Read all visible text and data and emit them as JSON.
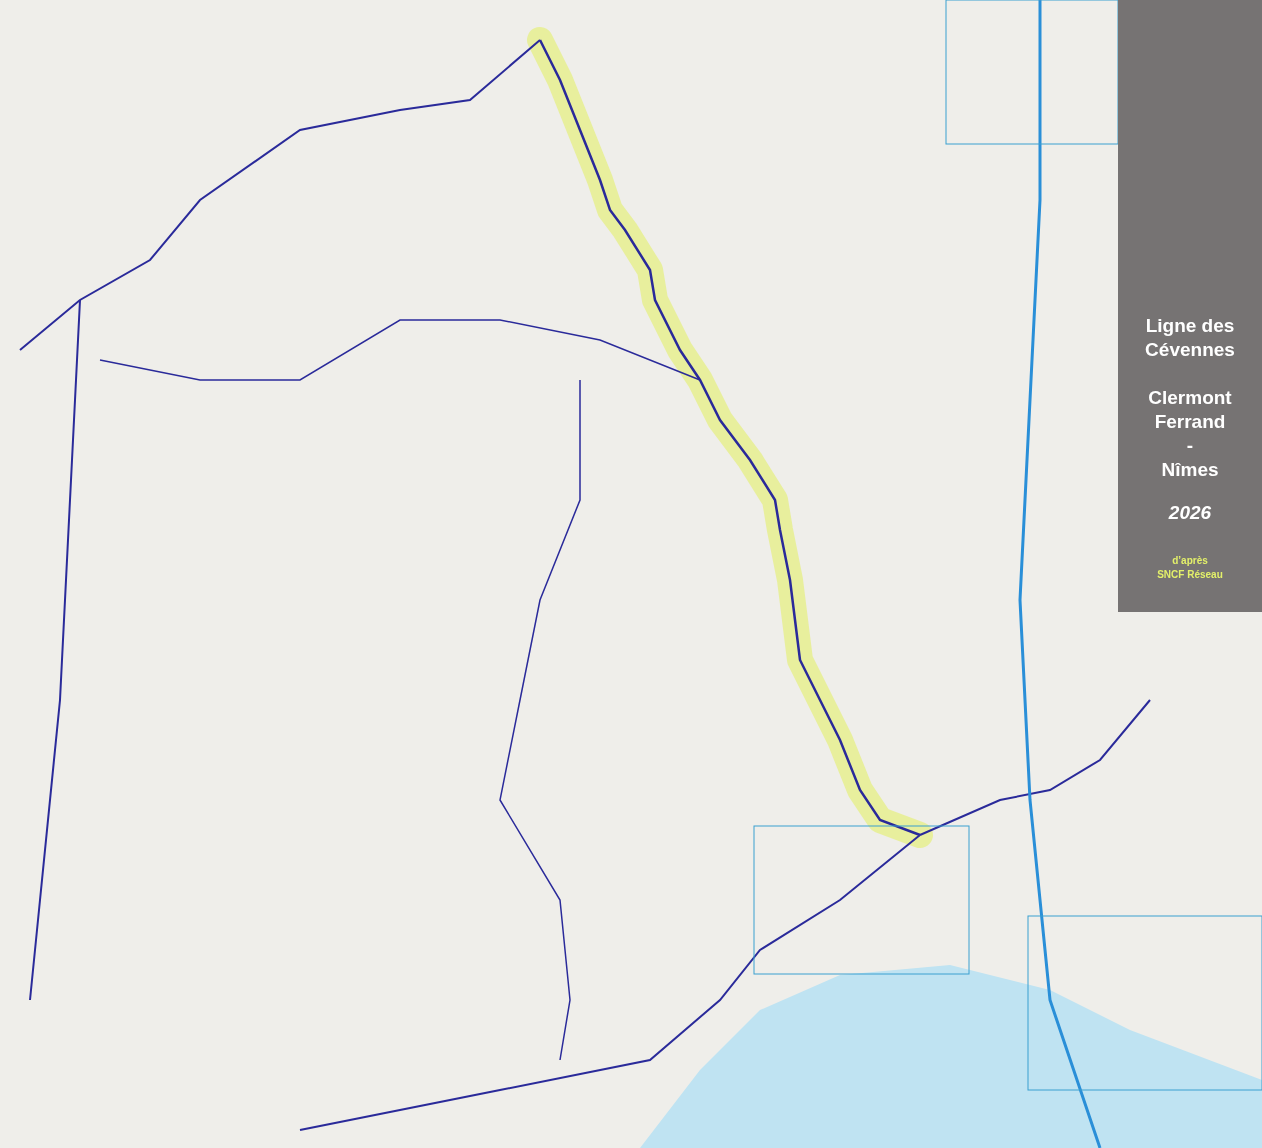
{
  "legend_panel": {
    "title_lines": [
      "Ligne des",
      "Cévennes"
    ],
    "route_lines": [
      "Clermont",
      "Ferrand",
      "-",
      "Nîmes"
    ],
    "year": "2026",
    "source_lines": [
      "d’après",
      "SNCF Réseau"
    ]
  }
}
